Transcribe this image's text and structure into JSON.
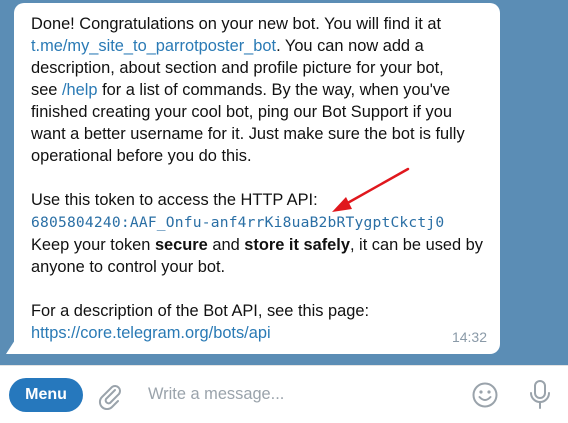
{
  "message": {
    "line1": "Done! Congratulations on your new bot. You will find it at",
    "bot_link": "t.me/my_site_to_parrotposter_bot",
    "line2_after_link": ". You can now add a",
    "line3": "description, about section and profile picture for your bot,",
    "line4_pre": "see ",
    "help_cmd": "/help",
    "line4_post": " for a list of commands. By the way, when you've",
    "line5": "finished creating your cool bot, ping our Bot Support if you",
    "line6": "want a better username for it. Just make sure the bot is fully",
    "line7": "operational before you do this.",
    "token_intro": "Use this token to access the HTTP API:",
    "token": "6805804240:AAF_Onfu-anf4rrKi8uaB2bRTygptCkctj0",
    "keep_pre": "Keep your token ",
    "keep_bold1": "secure",
    "keep_mid": " and ",
    "keep_bold2": "store it safely",
    "keep_post": ", it can be used by",
    "keep_line2": "anyone to control your bot.",
    "api_desc": "For a description of the Bot API, see this page:",
    "api_link": "https://core.telegram.org/bots/api",
    "time": "14:32"
  },
  "input_bar": {
    "menu_label": "Menu",
    "placeholder": "Write a message..."
  },
  "colors": {
    "chat_background": "#5b8db5",
    "link": "#2a7ab5",
    "menu_button": "#2678bd",
    "arrow": "#e0171d"
  },
  "icons": [
    "paperclip-icon",
    "emoji-icon",
    "microphone-icon",
    "red-arrow-annotation"
  ]
}
